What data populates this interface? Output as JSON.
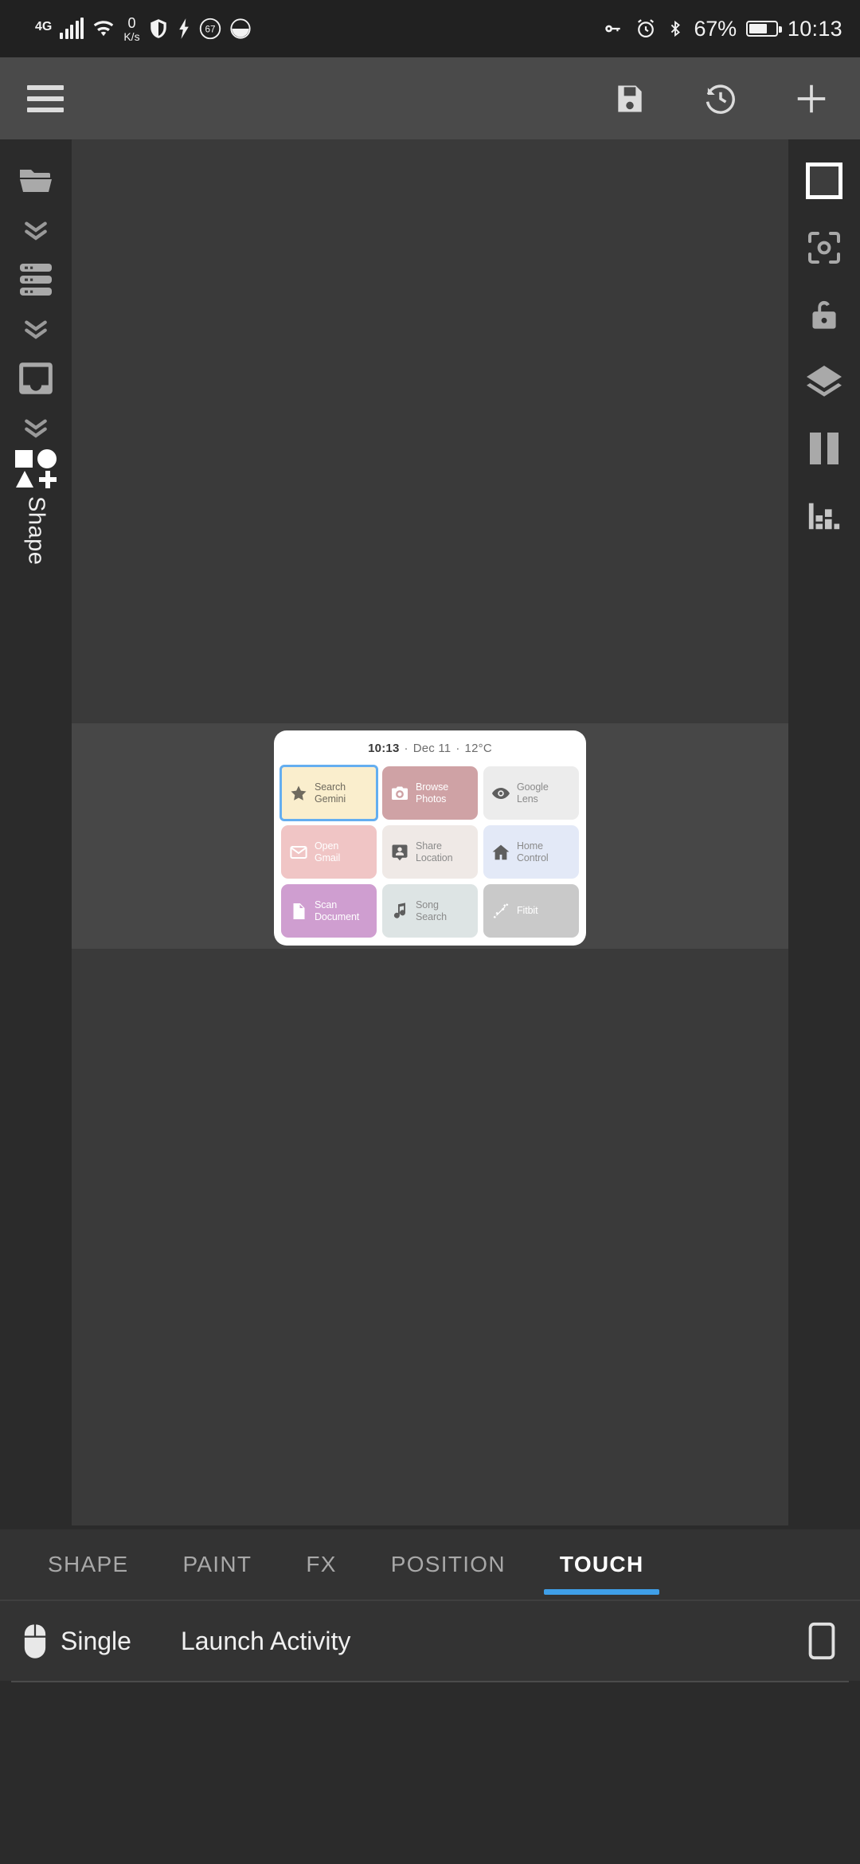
{
  "status_bar": {
    "network_type": "4G",
    "signal_icon": "signal-bars-icon",
    "wifi_icon": "wifi-icon",
    "data_rate_value": "0",
    "data_rate_unit": "K/s",
    "shield_icon": "shield-icon",
    "flash_icon": "lightning-bolt-icon",
    "circle_badge": "67",
    "moon_icon": "moon-icon",
    "key_icon": "vpn-key-icon",
    "alarm_icon": "alarm-clock-icon",
    "bluetooth_icon": "bluetooth-icon",
    "battery_percent": "67%",
    "battery_icon": "battery-icon",
    "time": "10:13"
  },
  "toolbar": {
    "menu_label": "menu",
    "menu_icon": "hamburger-menu-icon",
    "save_icon": "floppy-disk-save-icon",
    "history_icon": "history-restore-icon",
    "add_icon": "plus-add-icon"
  },
  "left_rail": {
    "items": [
      {
        "name": "open-folder",
        "icon": "folder-icon"
      },
      {
        "name": "expand-1",
        "icon": "double-chevron-down-icon"
      },
      {
        "name": "layers-list",
        "icon": "list-rows-icon"
      },
      {
        "name": "expand-2",
        "icon": "double-chevron-down-icon"
      },
      {
        "name": "canvas-frame",
        "icon": "frame-icon"
      },
      {
        "name": "expand-3",
        "icon": "double-chevron-down-icon"
      },
      {
        "name": "add-shape",
        "icon": "shapes-plus-icon"
      }
    ],
    "label": "Shape"
  },
  "right_rail": {
    "items": [
      {
        "name": "select-square",
        "icon": "square-outline-icon",
        "selected": true
      },
      {
        "name": "focus-target",
        "icon": "center-focus-icon",
        "selected": false
      },
      {
        "name": "lock-toggle",
        "icon": "unlock-icon",
        "selected": false
      },
      {
        "name": "layers",
        "icon": "layers-stack-icon",
        "selected": false
      },
      {
        "name": "pause",
        "icon": "pause-icon",
        "selected": false
      },
      {
        "name": "stats",
        "icon": "bar-chart-icon",
        "selected": false
      }
    ]
  },
  "widget": {
    "header": {
      "time": "10:13",
      "sep1": "·",
      "date": "Dec 11",
      "sep2": "·",
      "temperature": "12°C"
    },
    "tiles": [
      {
        "label_l1": "Search",
        "label_l2": "Gemini",
        "icon": "star-icon",
        "bg": "#faeecd",
        "fg": "#6f6a5e",
        "icon_color": "#6f6a5e",
        "selected": true
      },
      {
        "label_l1": "Browse",
        "label_l2": "Photos",
        "icon": "camera-icon",
        "bg": "#cfa2a5",
        "fg": "#ffffff",
        "icon_color": "#ffffff",
        "selected": false
      },
      {
        "label_l1": "Google",
        "label_l2": "Lens",
        "icon": "eye-icon",
        "bg": "#ececec",
        "fg": "#8b8b8b",
        "icon_color": "#5e5e5e",
        "selected": false
      },
      {
        "label_l1": "Open",
        "label_l2": "Gmail",
        "icon": "envelope-icon",
        "bg": "#f0c5c5",
        "fg": "#ffffff",
        "icon_color": "#ffffff",
        "selected": false
      },
      {
        "label_l1": "Share",
        "label_l2": "Location",
        "icon": "person-pin-icon",
        "bg": "#efe9e6",
        "fg": "#8b8b8b",
        "icon_color": "#5e5e5e",
        "selected": false
      },
      {
        "label_l1": "Home",
        "label_l2": "Control",
        "icon": "home-icon",
        "bg": "#e3e9f7",
        "fg": "#8b8b8b",
        "icon_color": "#5e5e5e",
        "selected": false
      },
      {
        "label_l1": "Scan",
        "label_l2": "Document",
        "icon": "document-icon",
        "bg": "#cf9ed0",
        "fg": "#ffffff",
        "icon_color": "#ffffff",
        "selected": false
      },
      {
        "label_l1": "Song",
        "label_l2": "Search",
        "icon": "music-note-icon",
        "bg": "#dde4e4",
        "fg": "#8b8b8b",
        "icon_color": "#5e5e5e",
        "selected": false
      },
      {
        "label_l1": "Fitbit",
        "label_l2": "",
        "icon": "dumbbell-icon",
        "bg": "#c9c9c9",
        "fg": "#ffffff",
        "icon_color": "#ffffff",
        "selected": false
      }
    ]
  },
  "tabs": {
    "items": [
      {
        "label": "SHAPE",
        "active": false
      },
      {
        "label": "PAINT",
        "active": false
      },
      {
        "label": "FX",
        "active": false
      },
      {
        "label": "POSITION",
        "active": false
      },
      {
        "label": "TOUCH",
        "active": true
      }
    ],
    "accent_color": "#3f9fe8"
  },
  "action_row": {
    "gesture_icon": "mouse-click-icon",
    "gesture": "Single",
    "action": "Launch Activity",
    "device_icon": "phone-outline-icon"
  }
}
